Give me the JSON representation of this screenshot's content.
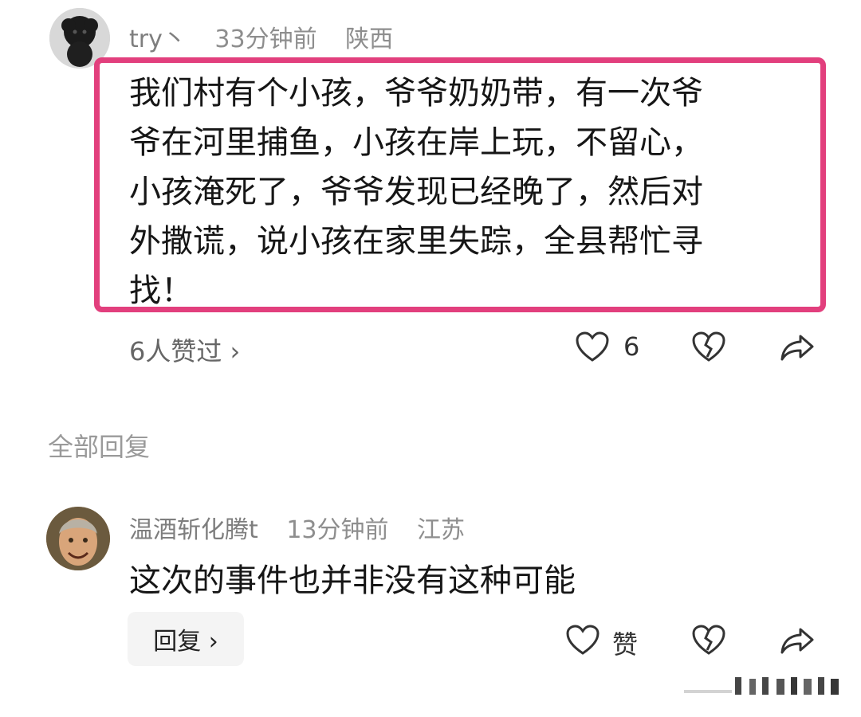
{
  "main_comment": {
    "username": "try丶",
    "time": "33分钟前",
    "location": "陕西",
    "lines": [
      "我们村有个小孩，爷爷奶奶带，有一次爷",
      "爷在河里捕鱼，小孩在岸上玩，不留心，",
      "小孩淹死了，爷爷发现已经晚了，然后对",
      "外撒谎，说小孩在家里失踪，全县帮忙寻",
      "找！"
    ],
    "likes_link": "6人赞过 ›",
    "like_count": "6",
    "icons": {
      "like": "heart-icon",
      "dislike": "broken-heart-icon",
      "share": "share-arrow-icon"
    },
    "highlight_color": "#e23f7d"
  },
  "replies_section": {
    "title": "全部回复"
  },
  "reply": {
    "username": "温酒斩化腾t",
    "time": "13分钟前",
    "location": "江苏",
    "text": "这次的事件也并非没有这种可能",
    "reply_button": "回复 ›",
    "like_label": "赞"
  }
}
